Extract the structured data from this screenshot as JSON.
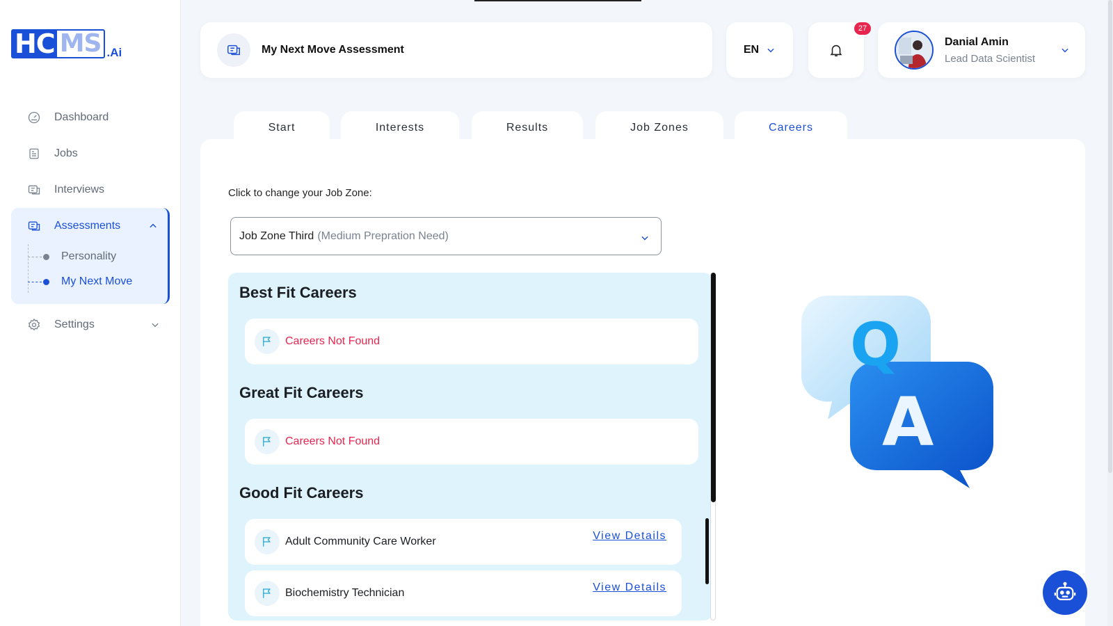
{
  "logo": {
    "hc": "HC",
    "ms": "MS",
    "ai": ".Ai"
  },
  "sidebar": {
    "items": [
      {
        "label": "Dashboard",
        "icon": "gauge-icon"
      },
      {
        "label": "Jobs",
        "icon": "jobs-icon"
      },
      {
        "label": "Interviews",
        "icon": "interviews-icon"
      },
      {
        "label": "Assessments",
        "icon": "assessments-icon",
        "expanded": true,
        "children": [
          {
            "label": "Personality",
            "active": false
          },
          {
            "label": "My Next Move",
            "active": true
          }
        ]
      },
      {
        "label": "Settings",
        "icon": "gear-icon",
        "expanded": false
      }
    ]
  },
  "header": {
    "title": "My Next Move Assessment",
    "language": "EN",
    "notification_count": "27",
    "user": {
      "name": "Danial Amin",
      "role": "Lead Data Scientist"
    }
  },
  "tabs": [
    {
      "label": "Start",
      "active": false
    },
    {
      "label": "Interests",
      "active": false
    },
    {
      "label": "Results",
      "active": false
    },
    {
      "label": "Job Zones",
      "active": false
    },
    {
      "label": "Careers",
      "active": true
    }
  ],
  "job_zone": {
    "label": "Click to change your Job Zone:",
    "selected": "Job Zone Third",
    "selected_note": "(Medium Prepration Need)"
  },
  "careers": {
    "best": {
      "title": "Best Fit Careers",
      "items": [
        "Careers Not Found"
      ]
    },
    "great": {
      "title": "Great Fit Careers",
      "items": [
        "Careers Not Found"
      ]
    },
    "good": {
      "title": "Good Fit Careers",
      "items": [
        {
          "name": "Adult Community Care Worker",
          "action": "View Details"
        },
        {
          "name": "Biochemistry Technician",
          "action": "View Details"
        }
      ]
    }
  },
  "colors": {
    "accent": "#1a4fd8",
    "error": "#e8254f",
    "list_bg": "#def3fc"
  }
}
